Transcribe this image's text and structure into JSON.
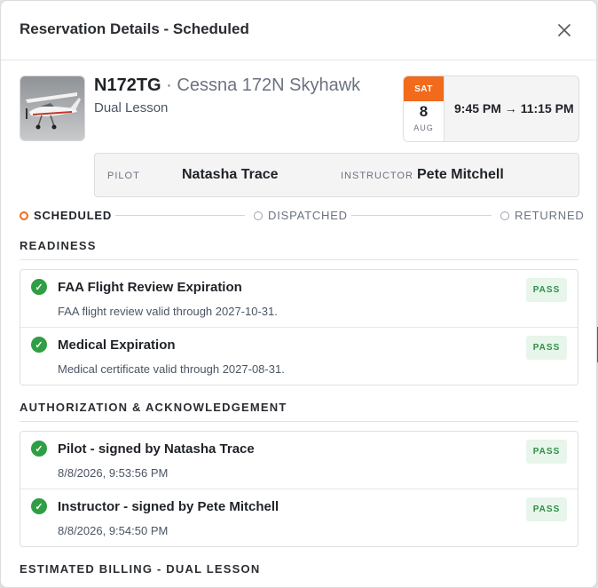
{
  "modal": {
    "title": "Reservation Details - Scheduled"
  },
  "aircraft": {
    "tail_number": "N172TG",
    "separator": " · ",
    "model": "Cessna 172N Skyhawk",
    "lesson_type": "Dual Lesson",
    "photo_icon": "aircraft-photo"
  },
  "schedule": {
    "day_of_week": "SAT",
    "day": "8",
    "month": "AUG",
    "time_range": "9:45 PM → 11:15 PM",
    "accent_color": "#f26a1b"
  },
  "crew": {
    "pilot_label": "PILOT",
    "pilot_name": "Natasha Trace",
    "instructor_label": "INSTRUCTOR",
    "instructor_name": "Pete Mitchell"
  },
  "status_steps": [
    {
      "label": "SCHEDULED",
      "active": true
    },
    {
      "label": "DISPATCHED",
      "active": false
    },
    {
      "label": "RETURNED",
      "active": false
    }
  ],
  "readiness": {
    "title": "READINESS",
    "items": [
      {
        "title": "FAA Flight Review Expiration",
        "detail": "FAA flight review valid through 2027-10-31.",
        "status": "PASS"
      },
      {
        "title": "Medical Expiration",
        "detail": "Medical certificate valid through 2027-08-31.",
        "status": "PASS"
      }
    ]
  },
  "authorization": {
    "title": "AUTHORIZATION & ACKNOWLEDGEMENT",
    "items": [
      {
        "title": "Pilot - signed by Natasha Trace",
        "detail": "8/8/2026, 9:53:56 PM",
        "status": "PASS"
      },
      {
        "title": "Instructor - signed by Pete Mitchell",
        "detail": "8/8/2026, 9:54:50 PM",
        "status": "PASS"
      }
    ]
  },
  "billing": {
    "title": "ESTIMATED BILLING - DUAL LESSON"
  },
  "colors": {
    "pass_green": "#2f9e44",
    "pass_badge_bg": "#e7f5ea"
  }
}
